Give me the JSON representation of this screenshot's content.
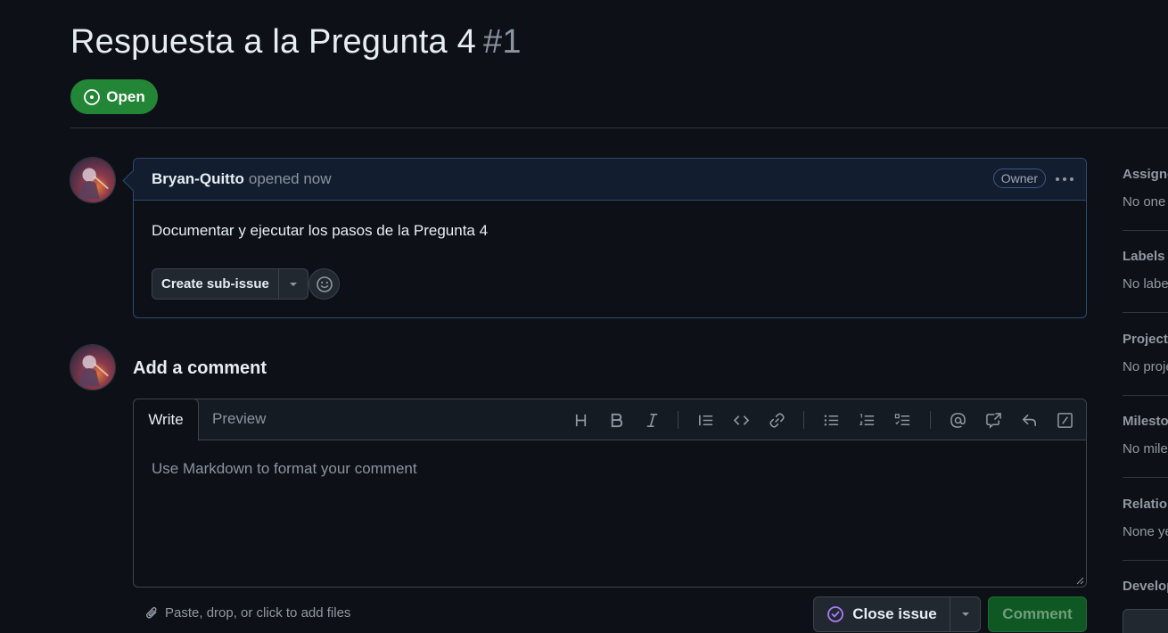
{
  "issue": {
    "title": "Respuesta a la Pregunta 4",
    "number": "#1",
    "state": "Open",
    "state_color": "#238636"
  },
  "comment": {
    "author": "Bryan-Quitto",
    "action": "opened now",
    "role_badge": "Owner",
    "menu_icon": "kebab-horizontal-icon",
    "body": "Documentar y ejecutar los pasos de la Pregunta 4",
    "create_subissue_label": "Create sub-issue",
    "reaction_icon": "smiley-icon"
  },
  "add_comment": {
    "heading": "Add a comment",
    "tabs": [
      "Write",
      "Preview"
    ],
    "active_tab": "Write",
    "toolbar_icons": [
      "heading-icon",
      "bold-icon",
      "italic-icon",
      "quote-icon",
      "code-icon",
      "link-icon",
      "unordered-list-icon",
      "ordered-list-icon",
      "task-list-icon",
      "mention-icon",
      "cross-reference-icon",
      "saved-reply-icon",
      "slash-command-icon"
    ],
    "placeholder": "Use Markdown to format your comment",
    "attach_hint": "Paste, drop, or click to add files",
    "close_issue_label": "Close issue",
    "submit_label": "Comment",
    "submit_color": "#105823"
  },
  "sidebar": {
    "sections": [
      {
        "heading": "Assignees",
        "value": "No one"
      },
      {
        "heading": "Labels",
        "value": "No labels"
      },
      {
        "heading": "Projects",
        "value": "No projects"
      },
      {
        "heading": "Milestone",
        "value": "No milestone"
      },
      {
        "heading": "Relationships",
        "value": "None yet"
      },
      {
        "heading": "Development",
        "value": ""
      }
    ]
  }
}
